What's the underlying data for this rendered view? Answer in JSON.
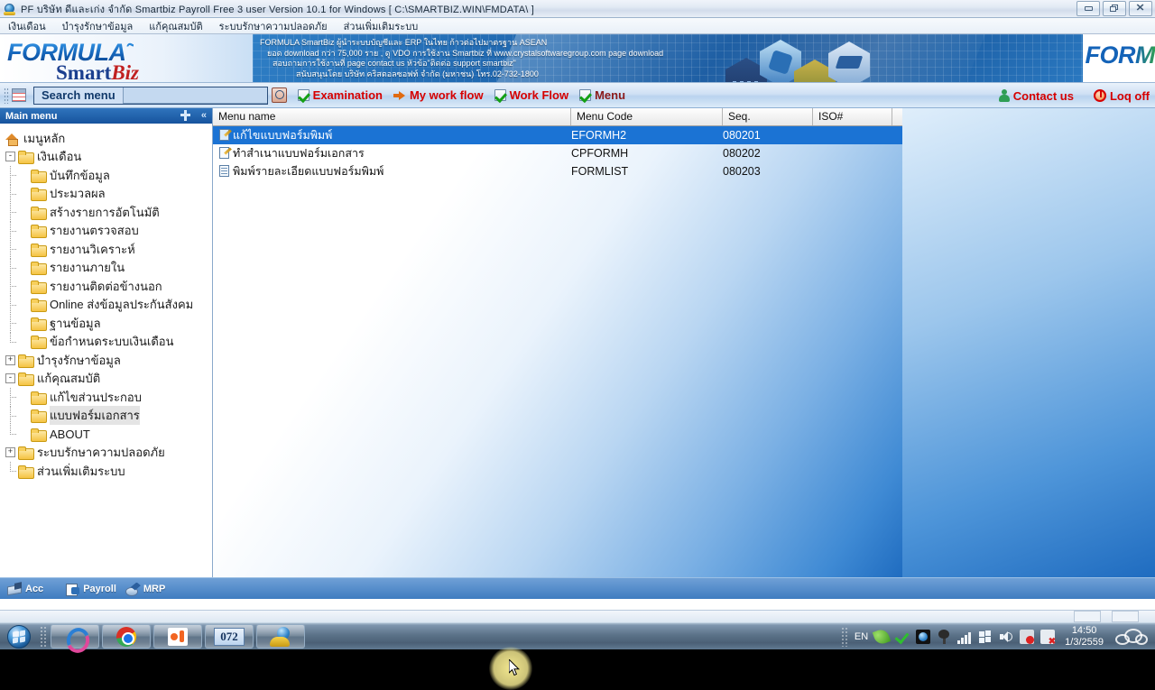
{
  "window": {
    "title": "PF บริษัท ดีและเก่ง จำกัด Smartbiz Payroll Free 3 user Version 10.1 for Windows [ C:\\SMARTBIZ.WIN\\FMDATA\\ ]",
    "icon": "globe-pedestal-icon",
    "buttons": {
      "minimize": "minimize",
      "restore": "restore",
      "close": "close"
    }
  },
  "menubar": {
    "items": [
      {
        "label": "เงินเดือน"
      },
      {
        "label": "บำรุงรักษาข้อมูล"
      },
      {
        "label": "แก้คุณสมบัติ"
      },
      {
        "label": "ระบบรักษาความปลอดภัย"
      },
      {
        "label": "ส่วนเพิ่มเติมระบบ"
      }
    ]
  },
  "banner": {
    "logo": {
      "formula": "FORMULA",
      "smart": "Smart",
      "biz": "Biz"
    },
    "logo_right": "FORM",
    "lines": [
      "FORMULA SmartBiz ผู้นำระบบบัญชีและ ERP ในไทย ก้าวต่อไปมาตรฐาน ASEAN",
      "ยอด download กว่า 75,000 ราย , ดู VDO การใช้งาน Smartbiz ที่ www.crystalsoftwaregroup.com page download",
      "สอบถามการใช้งานที่ page contact us หัวข้อ\"ติดต่อ support smartbiz\"",
      "สนับสนุนโดย บริษัท คริสตอลซอฟท์ จำกัด (มหาชน) โทร.02-732-1800"
    ]
  },
  "toolbar": {
    "search_label": "Search menu",
    "search_value": "",
    "search_placeholder": "",
    "search_button": "search-go-icon",
    "items": [
      {
        "label": "Examination",
        "icon": "green-check-icon",
        "color": "#d60000"
      },
      {
        "label": "My work flow",
        "icon": "orange-arrow-icon",
        "color": "#d60000"
      },
      {
        "label": "Work Flow",
        "icon": "green-check-icon",
        "color": "#d60000"
      },
      {
        "label": "Menu",
        "icon": "green-check-icon",
        "color": "#8b1a1a"
      }
    ],
    "contact_us": "Contact us",
    "log_off": "Loq off"
  },
  "sidebar": {
    "title": "Main menu",
    "pin_icon": "pin-icon",
    "collapse_icon": "double-chevron-left-icon",
    "root": {
      "label": "เมนูหลัก",
      "icon": "home-icon"
    },
    "items": [
      {
        "label": "เงินเดือน",
        "level": 1,
        "expander": "-",
        "icon": "folder-open-icon"
      },
      {
        "label": "บันทึกข้อมูล",
        "level": 2,
        "icon": "folder-icon"
      },
      {
        "label": "ประมวลผล",
        "level": 2,
        "icon": "folder-icon"
      },
      {
        "label": "สร้างรายการอัตโนมัติ",
        "level": 2,
        "icon": "folder-icon"
      },
      {
        "label": "รายงานตรวจสอบ",
        "level": 2,
        "icon": "folder-icon"
      },
      {
        "label": "รายงานวิเคราะห์",
        "level": 2,
        "icon": "folder-icon"
      },
      {
        "label": "รายงานภายใน",
        "level": 2,
        "icon": "folder-icon"
      },
      {
        "label": "รายงานติดต่อข้างนอก",
        "level": 2,
        "icon": "folder-icon"
      },
      {
        "label": "Online ส่งข้อมูลประกันสังคม",
        "level": 2,
        "icon": "folder-icon"
      },
      {
        "label": "ฐานข้อมูล",
        "level": 2,
        "icon": "folder-icon"
      },
      {
        "label": "ข้อกำหนดระบบเงินเดือน",
        "level": 2,
        "icon": "folder-icon",
        "last": true
      },
      {
        "label": "บำรุงรักษาข้อมูล",
        "level": 1,
        "expander": "+",
        "icon": "folder-icon"
      },
      {
        "label": "แก้คุณสมบัติ",
        "level": 1,
        "expander": "-",
        "icon": "folder-open-icon"
      },
      {
        "label": "แก้ไขส่วนประกอบ",
        "level": 2,
        "icon": "folder-icon"
      },
      {
        "label": "แบบฟอร์มเอกสาร",
        "level": 2,
        "icon": "folder-icon",
        "selected": true
      },
      {
        "label": "ABOUT",
        "level": 2,
        "icon": "folder-icon",
        "last": true
      },
      {
        "label": "ระบบรักษาความปลอดภัย",
        "level": 1,
        "expander": "+",
        "icon": "folder-icon"
      },
      {
        "label": "ส่วนเพิ่มเติมระบบ",
        "level": 1,
        "icon": "folder-icon",
        "last": true
      }
    ]
  },
  "grid": {
    "columns": [
      "Menu name",
      "Menu Code",
      "Seq.",
      "ISO#"
    ],
    "rows": [
      {
        "name": "แก้ไขแบบฟอร์มพิมพ์",
        "code": "EFORMH2",
        "seq": "080201",
        "iso": "",
        "icon": "edit-document-icon",
        "selected": true
      },
      {
        "name": "ทำสำเนาแบบฟอร์มเอกสาร",
        "code": "CPFORMH",
        "seq": "080202",
        "iso": "",
        "icon": "copy-document-icon",
        "selected": false
      },
      {
        "name": "พิมพ์รายละเอียดแบบฟอร์มพิมพ์",
        "code": "FORMLIST",
        "seq": "080203",
        "iso": "",
        "icon": "print-document-icon",
        "selected": false
      }
    ]
  },
  "statusbar": {
    "items": [
      {
        "label": "Acc",
        "icon": "acc-icon"
      },
      {
        "label": "Payroll",
        "icon": "payroll-icon"
      },
      {
        "label": "MRP",
        "icon": "mrp-icon"
      }
    ]
  },
  "taskbar": {
    "start": "start-orb-icon",
    "buttons": [
      {
        "icon": "swirl-app-icon"
      },
      {
        "icon": "chrome-icon"
      },
      {
        "icon": "orange-app-icon"
      },
      {
        "icon": "072-app-icon",
        "label": "072"
      },
      {
        "icon": "globe-pedestal-icon"
      }
    ],
    "tray": {
      "language": "EN",
      "icons": [
        "leaf-icon",
        "green-check-icon",
        "dark-globe-icon",
        "tree-icon",
        "signal-bars-icon",
        "windows-flag-icon",
        "speaker-icon",
        "red-alert-icon",
        "red-x-icon"
      ],
      "time": "14:50",
      "date": "1/3/2559",
      "cloud_icon": "cloud-icon"
    }
  }
}
